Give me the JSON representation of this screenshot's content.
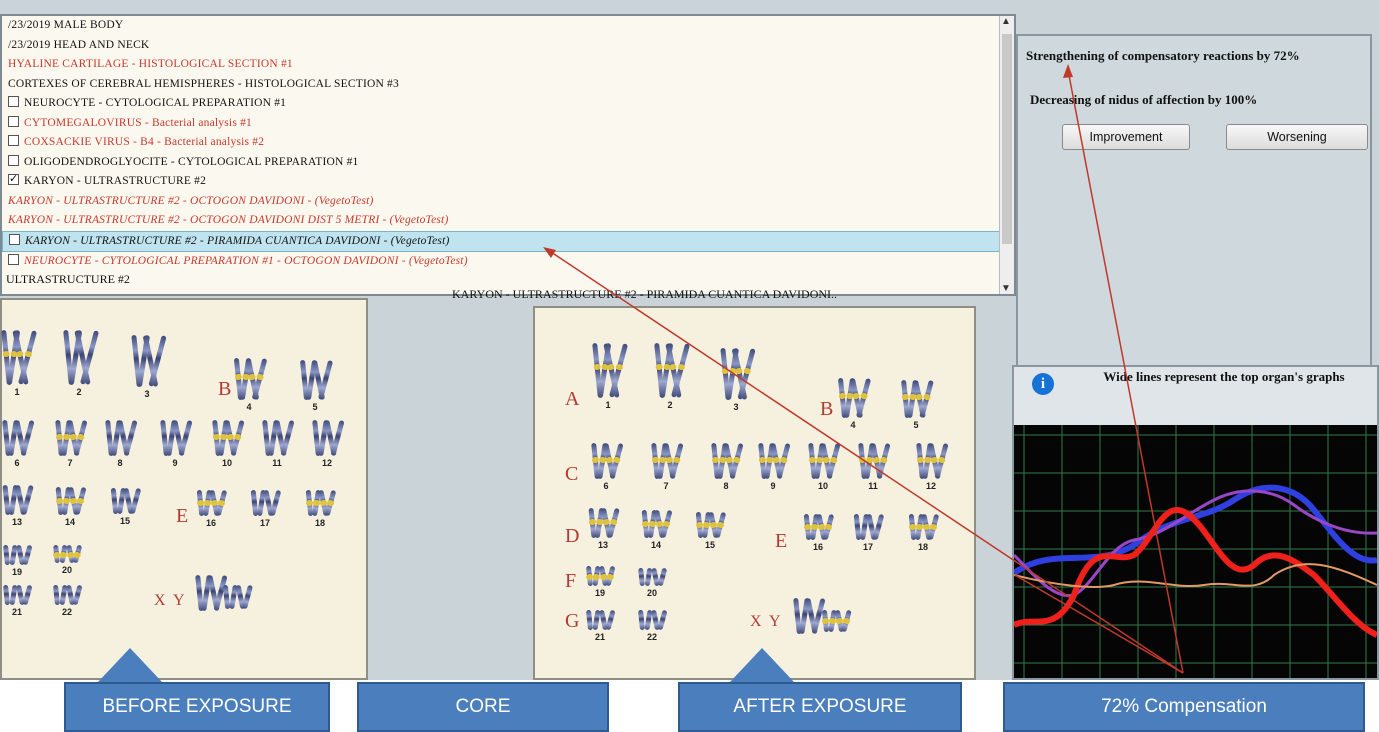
{
  "list": {
    "rows": [
      {
        "text": "/23/2019  MALE BODY",
        "color": "black",
        "checkbox": "none"
      },
      {
        "text": "/23/2019  HEAD AND NECK",
        "color": "black",
        "checkbox": "none"
      },
      {
        "text": "HYALINE CARTILAGE - HISTOLOGICAL SECTION #1",
        "color": "red",
        "checkbox": "none"
      },
      {
        "text": "CORTEXES OF CEREBRAL HEMISPHERES - HISTOLOGICAL SECTION #3",
        "color": "black",
        "checkbox": "none"
      },
      {
        "text": "NEUROCYTE - CYTOLOGICAL PREPARATION #1",
        "color": "black",
        "checkbox": "empty"
      },
      {
        "text": "CYTOMEGALOVIRUS - Bacterial analysis #1",
        "color": "red",
        "checkbox": "empty"
      },
      {
        "text": "COXSACKIE VIRUS - B4 - Bacterial analysis #2",
        "color": "red",
        "checkbox": "empty"
      },
      {
        "text": "OLIGODENDROGLYOCITE - CYTOLOGICAL PREPARATION #1",
        "color": "black",
        "checkbox": "empty"
      },
      {
        "text": "KARYON - ULTRASTRUCTURE #2",
        "color": "black",
        "checkbox": "checked"
      },
      {
        "text": "KARYON - ULTRASTRUCTURE #2 - OCTOGON DAVIDONI - (VegetoTest)",
        "color": "red",
        "checkbox": "none"
      },
      {
        "text": "KARYON - ULTRASTRUCTURE #2 - OCTOGON DAVIDONI DIST 5 METRI - (VegetoTest)",
        "color": "red",
        "checkbox": "none"
      },
      {
        "text": "KARYON - ULTRASTRUCTURE #2 - PIRAMIDA  CUANTICA DAVIDONI - (VegetoTest)",
        "color": "black",
        "checkbox": "empty",
        "selected": true
      },
      {
        "text": "NEUROCYTE - CYTOLOGICAL PREPARATION #1 - OCTOGON DAVIDONI - (VegetoTest)",
        "color": "red",
        "checkbox": "empty"
      }
    ]
  },
  "labels": {
    "left_section": "ULTRASTRUCTURE #2",
    "center_section": "KARYON - ULTRASTRUCTURE #2 - PIRAMIDA  CUANTICA DAVIDONI.."
  },
  "karyotype": {
    "groups_after": [
      "A",
      "B",
      "C",
      "D",
      "E",
      "F",
      "G"
    ],
    "groups_before": [
      "B",
      "E"
    ],
    "sex_label": "X Y",
    "numbers": [
      "1",
      "2",
      "3",
      "4",
      "5",
      "6",
      "7",
      "8",
      "9",
      "10",
      "11",
      "12",
      "13",
      "14",
      "15",
      "16",
      "17",
      "18",
      "19",
      "20",
      "21",
      "22"
    ]
  },
  "result": {
    "compensation_text": "Strengthening of compensatory reactions by 72%",
    "nidus_text": "Decreasing of nidus of affection by 100%",
    "improvement_label": "Improvement",
    "worsening_label": "Worsening"
  },
  "graph": {
    "info_glyph": "i",
    "hint": "Wide lines represent the top organ's graphs",
    "colors": {
      "blue": "#2f3fe0",
      "red": "#f0201a",
      "purple": "#9b46c8",
      "orange": "#e49a62",
      "grid": "#2f7a4a",
      "bg": "#050505"
    }
  },
  "callouts": {
    "before": "BEFORE EXPOSURE",
    "core": "CORE",
    "after": "AFTER EXPOSURE",
    "compensation": "72% Compensation",
    "fill": "#4a7ebd"
  }
}
